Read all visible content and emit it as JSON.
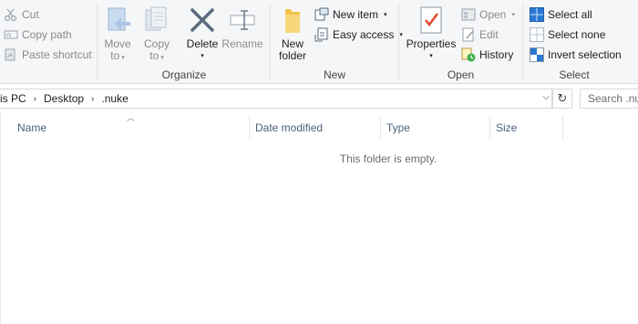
{
  "ribbon": {
    "clipboard": {
      "cut": "Cut",
      "copy_path": "Copy path",
      "paste_shortcut": "Paste shortcut"
    },
    "organize": {
      "label": "Organize",
      "move_to": "Move",
      "move_to_sub": "to",
      "copy_to": "Copy",
      "copy_to_sub": "to",
      "delete": "Delete",
      "rename": "Rename"
    },
    "new": {
      "label": "New",
      "new_folder": "New",
      "new_folder_sub": "folder",
      "new_item": "New item",
      "easy_access": "Easy access"
    },
    "open": {
      "label": "Open",
      "properties": "Properties",
      "open": "Open",
      "edit": "Edit",
      "history": "History"
    },
    "select": {
      "label": "Select",
      "select_all": "Select all",
      "select_none": "Select none",
      "invert_selection": "Invert selection"
    }
  },
  "address": {
    "crumbs": [
      "is PC",
      "Desktop",
      ".nuke"
    ],
    "search_placeholder": "Search .nuke"
  },
  "columns": {
    "name": "Name",
    "date_modified": "Date modified",
    "type": "Type",
    "size": "Size"
  },
  "content": {
    "empty_message": "This folder is empty."
  },
  "colors": {
    "accent_blue": "#2b78d4",
    "header_text": "#4c607a",
    "folder_yellow": "#f0c24a"
  }
}
